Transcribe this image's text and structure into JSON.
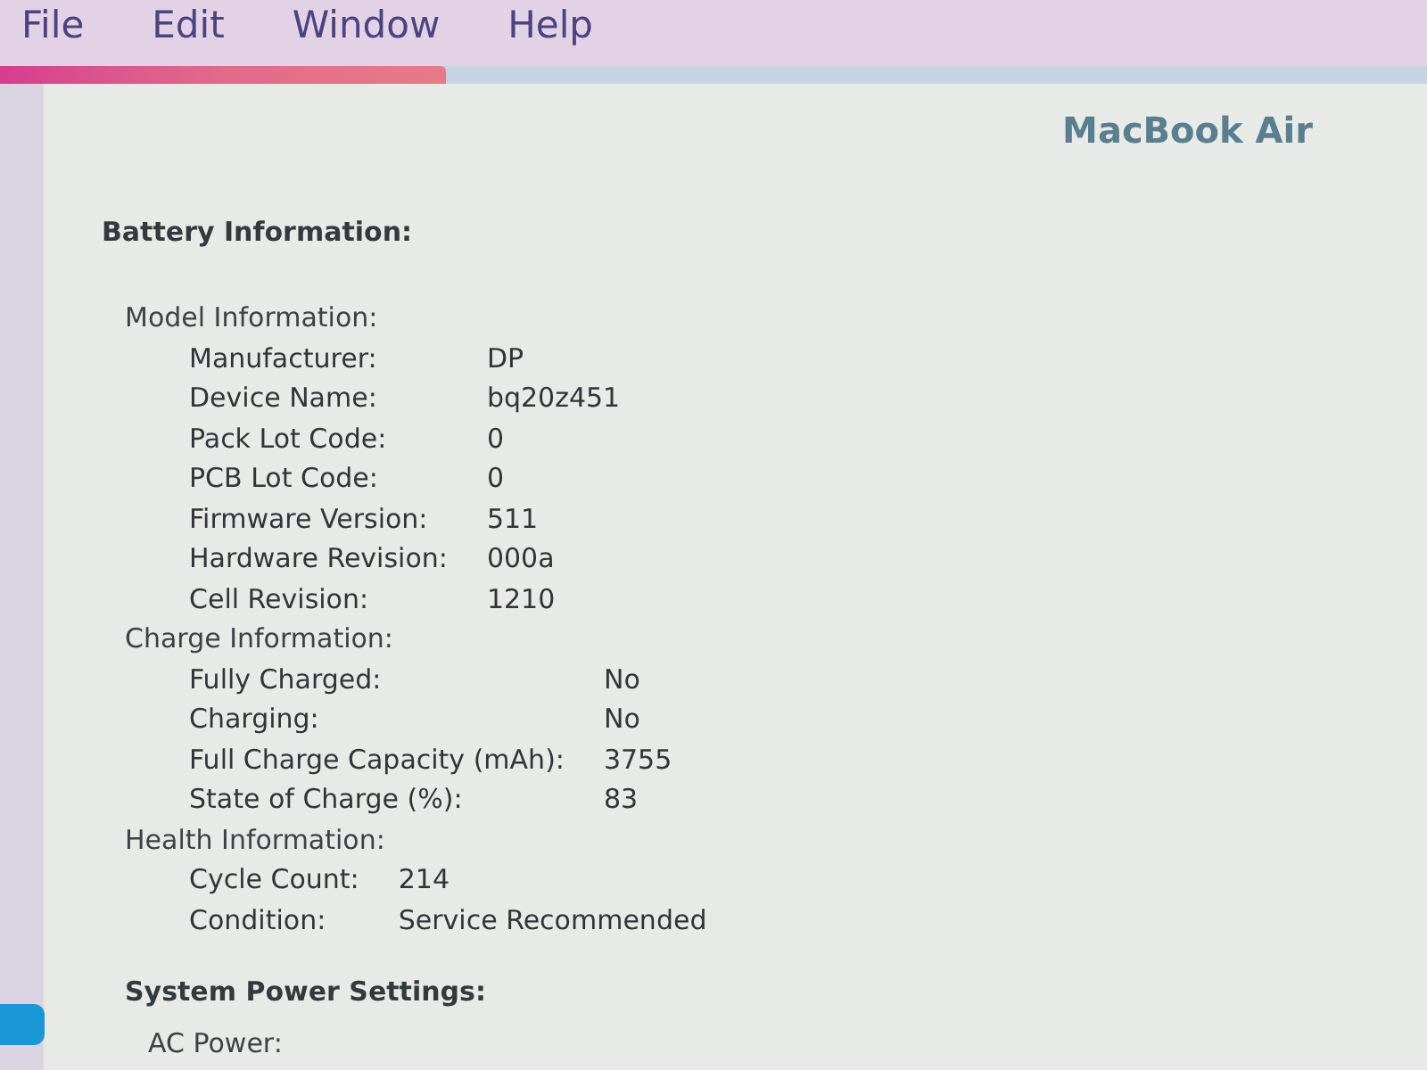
{
  "menu_bar": {
    "items": [
      "File",
      "Edit",
      "Window",
      "Help"
    ]
  },
  "sidebar": {
    "items": [
      {
        "selected": true
      }
    ]
  },
  "title": "MacBook Air",
  "sections": [
    {
      "heading": "Battery Information:",
      "groups": [
        {
          "heading": "Model Information:",
          "rows": [
            {
              "label": "Manufacturer:",
              "value": "DP"
            },
            {
              "label": "Device Name:",
              "value": "bq20z451"
            },
            {
              "label": "Pack Lot Code:",
              "value": "0"
            },
            {
              "label": "PCB Lot Code:",
              "value": "0"
            },
            {
              "label": "Firmware Version:",
              "value": "511"
            },
            {
              "label": "Hardware Revision:",
              "value": "000a"
            },
            {
              "label": "Cell Revision:",
              "value": "1210"
            }
          ]
        },
        {
          "heading": "Charge Information:",
          "rows": [
            {
              "label": "Fully Charged:",
              "value": "No"
            },
            {
              "label": "Charging:",
              "value": "No"
            },
            {
              "label": "Full Charge Capacity (mAh):",
              "value": "3755"
            },
            {
              "label": "State of Charge (%):",
              "value": "83"
            }
          ]
        },
        {
          "heading": "Health Information:",
          "rows": [
            {
              "label": "Cycle Count:",
              "value": "214"
            },
            {
              "label": "Condition:",
              "value": "Service Recommended"
            }
          ]
        }
      ]
    },
    {
      "heading": "System Power Settings:",
      "groups": [
        {
          "heading": "AC Power:"
        }
      ]
    }
  ]
}
